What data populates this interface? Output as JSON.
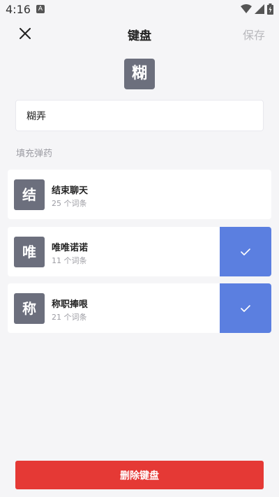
{
  "status_bar": {
    "time": "4:16",
    "notification_letter": "A"
  },
  "header": {
    "title": "键盘",
    "save_label": "保存"
  },
  "keyboard": {
    "char": "糊",
    "name_value": "糊弄",
    "name_placeholder": ""
  },
  "section": {
    "label": "填充弹药"
  },
  "items": [
    {
      "char": "结",
      "title": "结束聊天",
      "subtitle": "25 个词条",
      "selected": false
    },
    {
      "char": "唯",
      "title": "唯唯诺诺",
      "subtitle": "11 个词条",
      "selected": true
    },
    {
      "char": "称",
      "title": "称职捧哏",
      "subtitle": "21 个词条",
      "selected": true
    }
  ],
  "footer": {
    "delete_label": "删除键盘"
  },
  "colors": {
    "background": "#f5f5f7",
    "tile": "#6c6f7d",
    "selected": "#5b7fe0",
    "danger": "#e53935",
    "muted": "#9c9ca3"
  }
}
